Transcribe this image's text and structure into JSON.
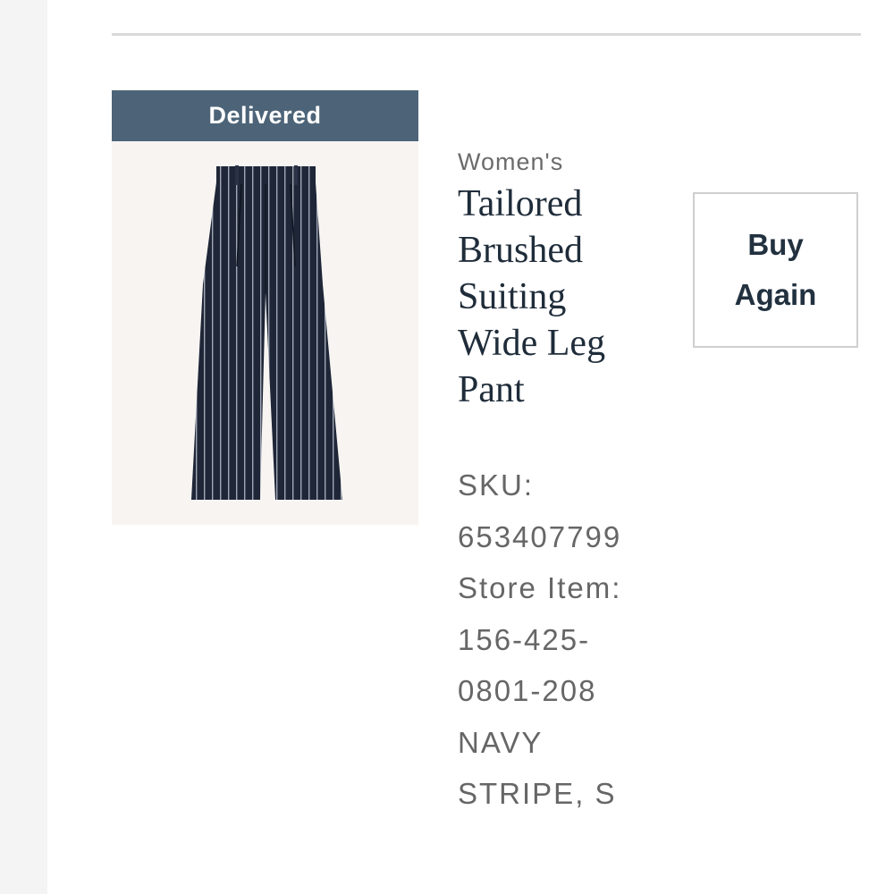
{
  "order_item": {
    "status": "Delivered",
    "category": "Women's",
    "name": "Tailored Brushed Suiting Wide Leg Pant",
    "sku_label": "SKU:",
    "sku_value": "653407799",
    "store_item_label": "Store Item:",
    "store_item_value_line1": "156-425-",
    "store_item_value_line2": "0801-208",
    "variant_line1": "NAVY",
    "variant_line2": "STRIPE, S",
    "image_icon": "striped-wide-leg-pants-image"
  },
  "actions": {
    "buy_again_line1": "Buy",
    "buy_again_line2": "Again"
  },
  "colors": {
    "status_banner": "#4d6478",
    "product_name": "#1f2c3a",
    "meta_text": "#666666",
    "pants": "#1e2637"
  }
}
